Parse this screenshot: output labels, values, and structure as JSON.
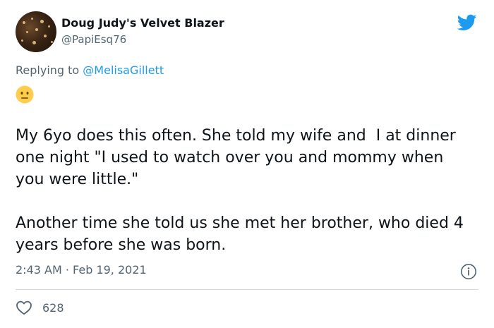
{
  "author": {
    "display_name": "Doug Judy's Velvet Blazer",
    "handle": "@PapiEsq76"
  },
  "reply": {
    "prefix": "Replying to ",
    "target": "@MelisaGillett"
  },
  "emoji": "neutral-face-emoji",
  "tweet": {
    "paragraph_1": "My 6yo does this often. She told my wife and  I at dinner one night \"I used to watch over you and mommy when you were little.\"",
    "paragraph_2": "Another time she told us she met her brother, who died 4 years before she was born."
  },
  "timestamp": "2:43 AM · Feb 19, 2021",
  "likes": "628",
  "colors": {
    "brand": "#1d9bf0",
    "muted": "#536471",
    "text": "#0f1419",
    "divider": "#cfd9de"
  },
  "icons": [
    "twitter-bird-icon",
    "info-icon",
    "heart-icon"
  ]
}
